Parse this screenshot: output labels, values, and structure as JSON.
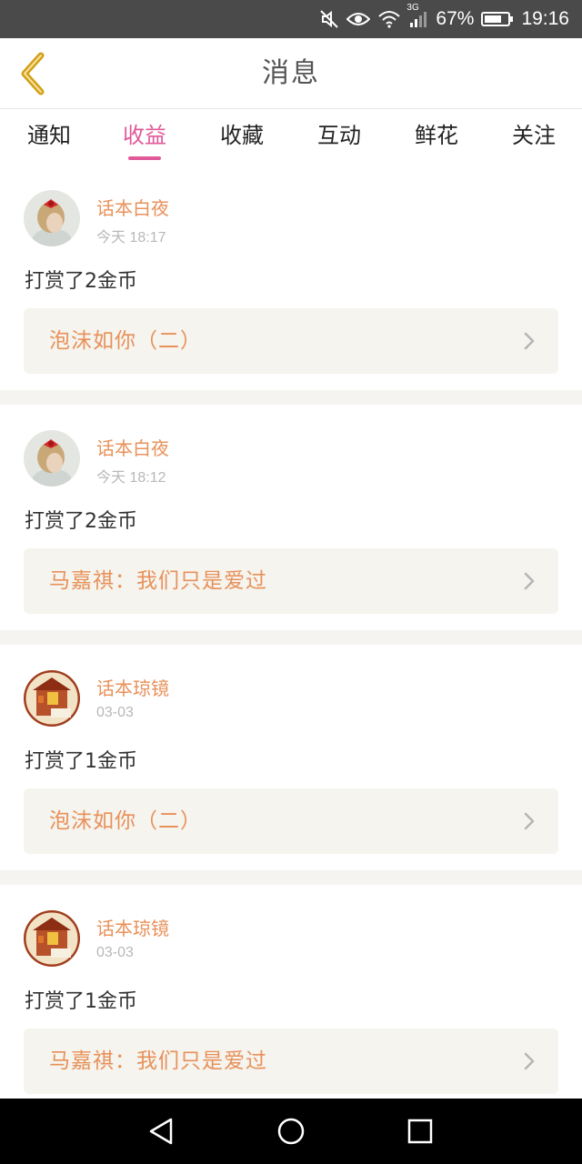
{
  "status_bar": {
    "network": "3G",
    "battery": "67%",
    "time": "19:16",
    "icons": [
      "mute-icon",
      "eye-icon",
      "wifi-icon",
      "signal-icon",
      "battery-icon"
    ]
  },
  "header": {
    "title": "消息",
    "back_icon": "back-chevron-icon",
    "accent_color": "#d4a017"
  },
  "tabs": [
    {
      "label": "通知",
      "active": false
    },
    {
      "label": "收益",
      "active": true
    },
    {
      "label": "收藏",
      "active": false
    },
    {
      "label": "互动",
      "active": false
    },
    {
      "label": "鲜花",
      "active": false
    },
    {
      "label": "关注",
      "active": false
    }
  ],
  "colors": {
    "active_tab": "#e05a9a",
    "username": "#e8915a",
    "book_title": "#e8915a",
    "book_bg": "#f5f4ee"
  },
  "messages": [
    {
      "user": "话本白夜",
      "time": "今天 18:17",
      "text": "打赏了2金币",
      "book": "泡沫如你（二）",
      "avatar": "girl-avatar"
    },
    {
      "user": "话本白夜",
      "time": "今天 18:12",
      "text": "打赏了2金币",
      "book": "马嘉祺：我们只是爱过",
      "avatar": "girl-avatar"
    },
    {
      "user": "话本琼镜",
      "time": "03-03",
      "text": "打赏了1金币",
      "book": "泡沫如你（二）",
      "avatar": "shrine-avatar"
    },
    {
      "user": "话本琼镜",
      "time": "03-03",
      "text": "打赏了1金币",
      "book": "马嘉祺：我们只是爱过",
      "avatar": "shrine-avatar"
    }
  ],
  "nav": [
    "back-triangle-icon",
    "home-circle-icon",
    "recents-square-icon"
  ]
}
